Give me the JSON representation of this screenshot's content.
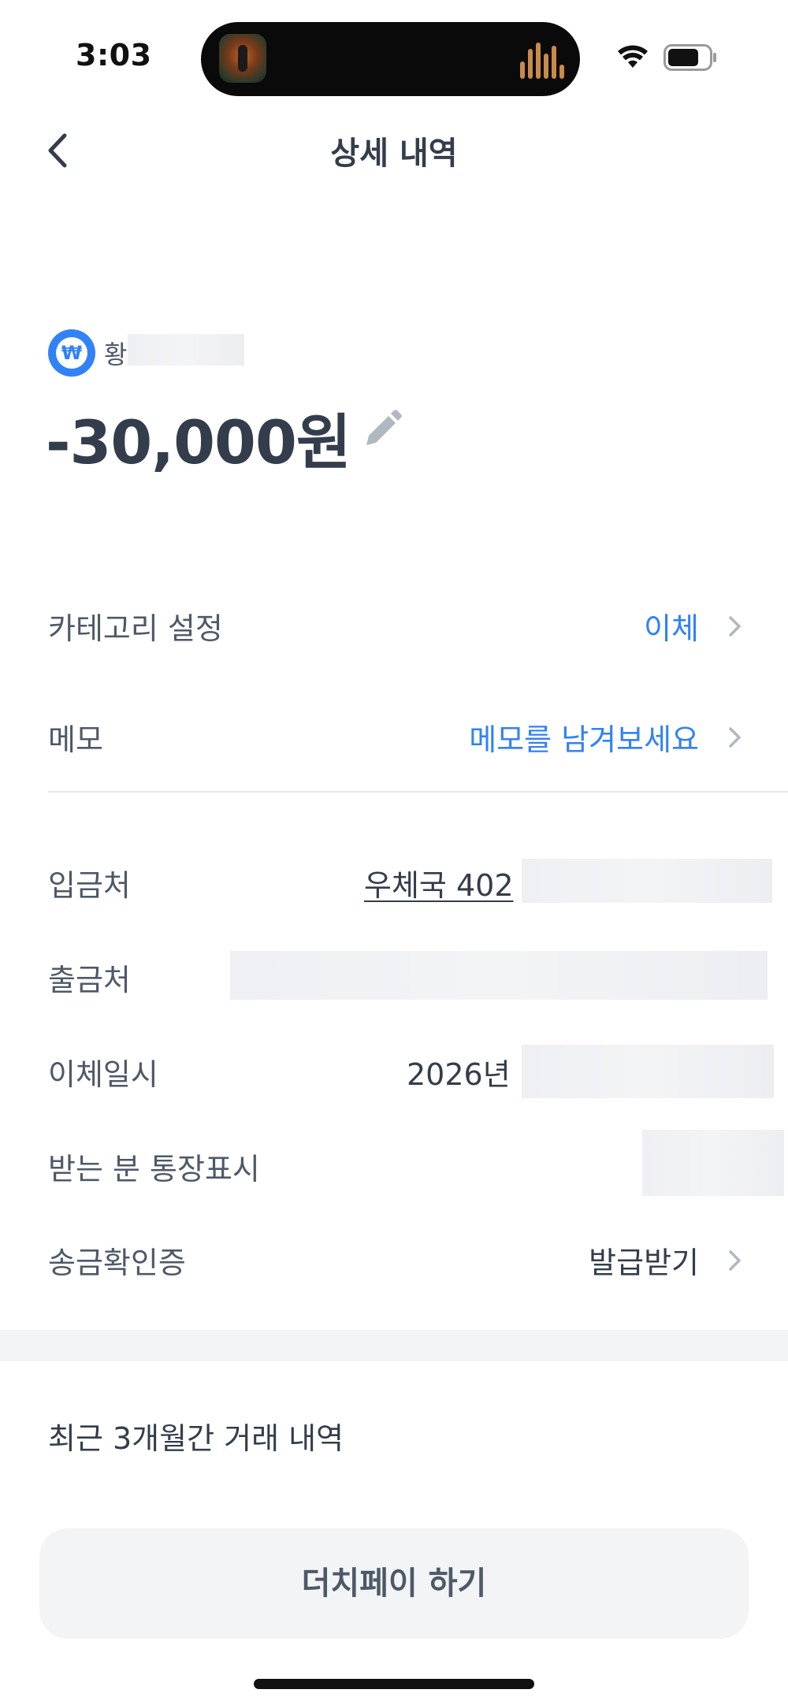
{
  "status_bar": {
    "time": "3:03"
  },
  "header": {
    "title": "상세 내역"
  },
  "account": {
    "name_visible": "황",
    "icon_symbol": "₩",
    "icon_color": "#3182f6"
  },
  "amount": "-30,000원",
  "rows": {
    "category": {
      "label": "카테고리 설정",
      "value": "이체"
    },
    "memo": {
      "label": "메모",
      "value": "메모를 남겨보세요"
    },
    "deposit_to": {
      "label": "입금처",
      "value": "우체국 402"
    },
    "withdraw_from": {
      "label": "출금처"
    },
    "transfer_datetime": {
      "label": "이체일시",
      "value": "2026년"
    },
    "recipient_display": {
      "label": "받는 분 통장표시"
    },
    "confirmation": {
      "label": "송금확인증",
      "value": "발급받기"
    }
  },
  "history": {
    "title": "최근 3개월간 거래 내역"
  },
  "dutch_pay": {
    "label": "더치페이 하기"
  },
  "colors": {
    "accent": "#3182f6",
    "text_primary": "#333d4b",
    "text_secondary": "#4e5968",
    "button_bg": "#f2f4f6"
  }
}
